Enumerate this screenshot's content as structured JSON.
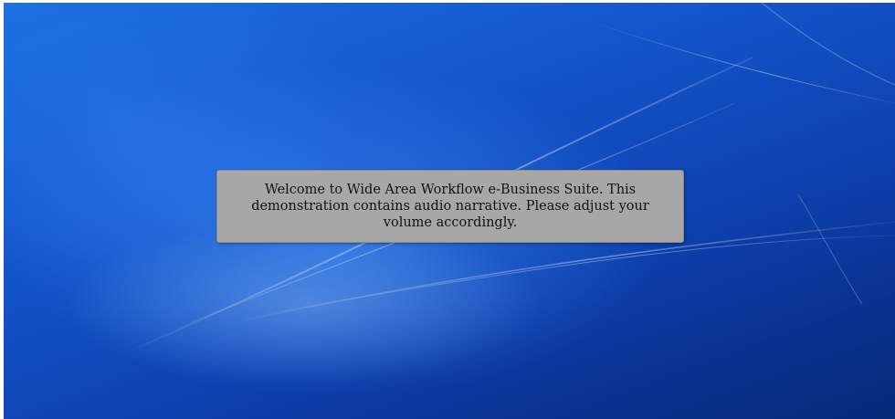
{
  "caption": {
    "text": "Welcome to Wide Area Workflow e-Business Suite. This demonstration contains audio narrative. Please adjust your volume accordingly."
  },
  "colors": {
    "desktop_background": "#1559d0",
    "caption_background": "#a7a7a7",
    "caption_text": "#111111"
  }
}
